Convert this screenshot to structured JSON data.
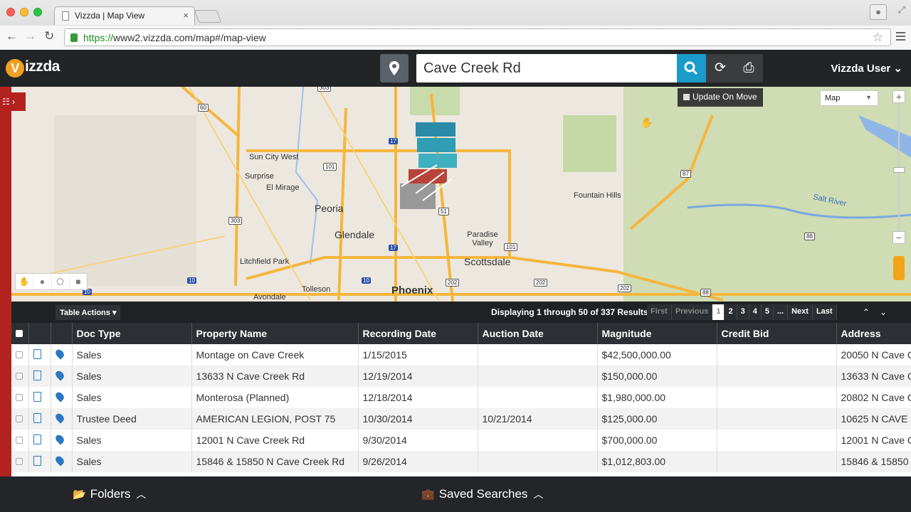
{
  "browser": {
    "tab_title": "Vizzda | Map View",
    "tab_close": "×",
    "url_scheme": "https://",
    "url_rest": "www2.vizzda.com/map#/map-view"
  },
  "app": {
    "logo_text": "izzda",
    "logo_letter": "V",
    "search_value": "Cave Creek Rd",
    "user_label": "Vizzda User ⌄"
  },
  "map": {
    "update_label": "Update On Move",
    "type_select": "Map",
    "labels": [
      "Sun City West",
      "Surprise",
      "El Mirage",
      "Peoria",
      "Glendale",
      "Litchfield Park",
      "Tolleson",
      "Avondale",
      "Phoenix",
      "Paradise Valley",
      "Scottsdale",
      "Fountain Hills",
      "Salt River"
    ],
    "highways": [
      "303",
      "60",
      "101",
      "17",
      "51",
      "17",
      "101",
      "303",
      "10",
      "10",
      "202",
      "202",
      "202",
      "87",
      "88",
      "88",
      "10"
    ]
  },
  "results": {
    "table_actions": "Table Actions ▾",
    "display_text": "Displaying 1 through 50 of 337 Results",
    "pager": [
      "First",
      "Previous",
      "1",
      "2",
      "3",
      "4",
      "5",
      "...",
      "Next",
      "Last"
    ]
  },
  "table": {
    "columns": [
      "Doc Type",
      "Property Name",
      "Recording Date",
      "Auction Date",
      "Magnitude",
      "Credit Bid",
      "Address"
    ],
    "rows": [
      [
        "Sales",
        "Montage on Cave Creek",
        "1/15/2015",
        "",
        "$42,500,000.00",
        "",
        "20050 N Cave C"
      ],
      [
        "Sales",
        "13633 N Cave Creek Rd",
        "12/19/2014",
        "",
        "$150,000.00",
        "",
        "13633 N Cave C"
      ],
      [
        "Sales",
        "Monterosa (Planned)",
        "12/18/2014",
        "",
        "$1,980,000.00",
        "",
        "20802 N Cave C"
      ],
      [
        "Trustee Deed",
        "AMERICAN LEGION, POST 75",
        "10/30/2014",
        "10/21/2014",
        "$125,000.00",
        "",
        "10625 N CAVE C"
      ],
      [
        "Sales",
        "12001 N Cave Creek Rd",
        "9/30/2014",
        "",
        "$700,000.00",
        "",
        "12001 N Cave C"
      ],
      [
        "Sales",
        "15846 & 15850 N Cave Creek Rd",
        "9/26/2014",
        "",
        "$1,012,803.00",
        "",
        "15846 & 15850"
      ]
    ]
  },
  "footer": {
    "folders": "Folders",
    "saved_searches": "Saved Searches"
  },
  "colors": {
    "accent": "#1a9bcb",
    "brand_red": "#b3221f",
    "logo_orange": "#f0a020"
  }
}
